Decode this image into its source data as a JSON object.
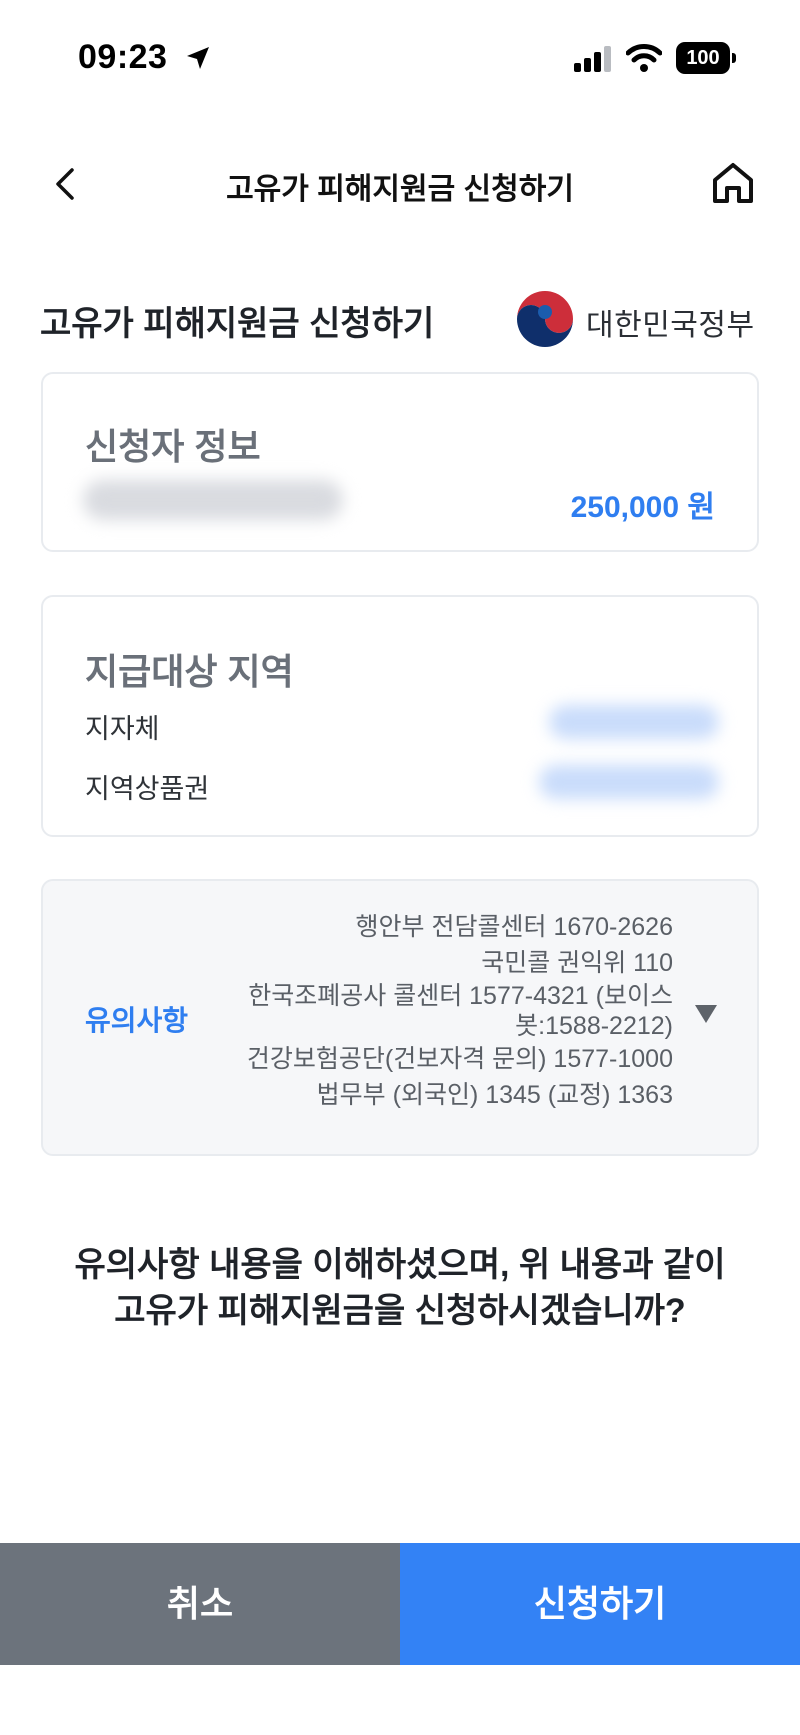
{
  "status_bar": {
    "time": "09:23",
    "battery": "100"
  },
  "nav": {
    "title": "고유가 피해지원금 신청하기"
  },
  "section": {
    "title": "고유가 피해지원금 신청하기",
    "org_name": "대한민국정부"
  },
  "applicant": {
    "title": "신청자 정보",
    "amount": "250,000 원"
  },
  "region": {
    "title": "지급대상 지역",
    "rows": [
      {
        "label": "지자체"
      },
      {
        "label": "지역상품권"
      }
    ]
  },
  "notice": {
    "label": "유의사항",
    "lines": [
      "행안부 전담콜센터 1670-2626",
      "국민콜 권익위 110",
      "한국조폐공사 콜센터 1577-4321 (보이스",
      "봇:1588-2212)",
      "건강보험공단(건보자격 문의) 1577-1000",
      "법무부 (외국인) 1345 (교정) 1363"
    ]
  },
  "confirm": {
    "line1": "유의사항 내용을 이해하셨으며, 위 내용과 같이",
    "line2": "고유가 피해지원금을 신청하시겠습니까?"
  },
  "buttons": {
    "cancel": "취소",
    "apply": "신청하기"
  },
  "colors": {
    "accent": "#3382f5",
    "cancel": "#6c737c",
    "amount": "#2f7ef0"
  }
}
